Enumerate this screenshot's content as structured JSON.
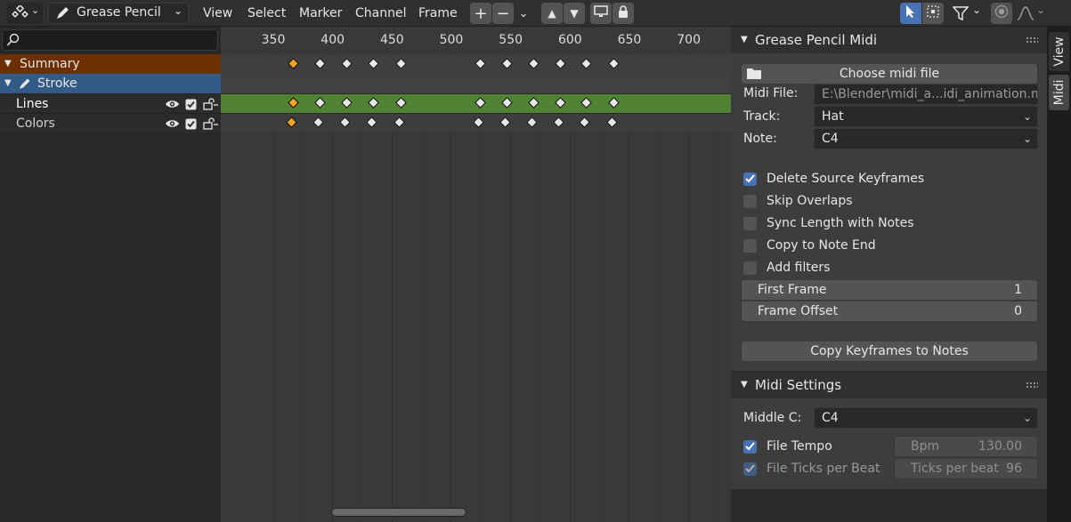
{
  "header": {
    "editor_mode": "Grease Pencil",
    "menus": [
      "View",
      "Select",
      "Marker",
      "Channel",
      "Frame"
    ],
    "icons": {
      "editor_type": "dopesheet-editor-icon",
      "mode": "grease-pencil-icon",
      "add": "plus-icon",
      "remove": "minus-icon",
      "expand": "chevron-down-icon",
      "move_up": "triangle-up-icon",
      "move_down": "triangle-down-icon",
      "display": "monitor-icon",
      "lock": "lock-icon",
      "select_tool": "cursor-arrow-icon",
      "box_select": "box-select-icon",
      "filter": "filter-funnel-icon",
      "proportional": "proportional-edit-icon",
      "falloff": "falloff-curve-icon"
    }
  },
  "channels": {
    "search_value": "",
    "summary": "Summary",
    "stroke": "Stroke",
    "layers": [
      {
        "name": "Lines",
        "selected": true
      },
      {
        "name": "Colors",
        "selected": false
      }
    ]
  },
  "timeline": {
    "ticks": [
      "350",
      "400",
      "450",
      "500",
      "550",
      "600",
      "650",
      "700"
    ],
    "keyframe_frames": [
      367,
      390,
      412,
      435,
      458,
      525,
      547,
      570,
      592,
      614,
      637
    ],
    "active_keyframe_frame": 367
  },
  "sidebar": {
    "panel1": {
      "title": "Grease Pencil Midi",
      "choose_file_label": "Choose midi file",
      "midi_file_label": "Midi File:",
      "midi_file_value": "E:\\Blender\\midi_a...idi_animation.mid",
      "track_label": "Track:",
      "track_value": "Hat",
      "note_label": "Note:",
      "note_value": "C4",
      "checkboxes": [
        {
          "label": "Delete Source Keyframes",
          "checked": true
        },
        {
          "label": "Skip Overlaps",
          "checked": false
        },
        {
          "label": "Sync Length with Notes",
          "checked": false
        },
        {
          "label": "Copy to Note End",
          "checked": false
        },
        {
          "label": "Add filters",
          "checked": false
        }
      ],
      "first_frame_label": "First Frame",
      "first_frame_value": "1",
      "frame_offset_label": "Frame Offset",
      "frame_offset_value": "0",
      "copy_button_label": "Copy Keyframes to Notes"
    },
    "panel2": {
      "title": "Midi Settings",
      "middle_c_label": "Middle C:",
      "middle_c_value": "C4",
      "file_tempo_label": "File Tempo",
      "file_tempo_checked": true,
      "bpm_label": "Bpm",
      "bpm_value": "130.00",
      "ticks_label": "File Ticks per Beat",
      "ticks_checked": true,
      "ticks_field_label": "Ticks per beat",
      "ticks_field_value": "96"
    }
  },
  "tabs": [
    "View",
    "Midi"
  ],
  "colors": {
    "accent": "#4772b3",
    "summary_bg": "#6b2f00",
    "stroke_bg": "#335b87",
    "selected_row": "#508234",
    "keyframe_active": "#f2a52a",
    "keyframe": "#e8e8e8"
  }
}
